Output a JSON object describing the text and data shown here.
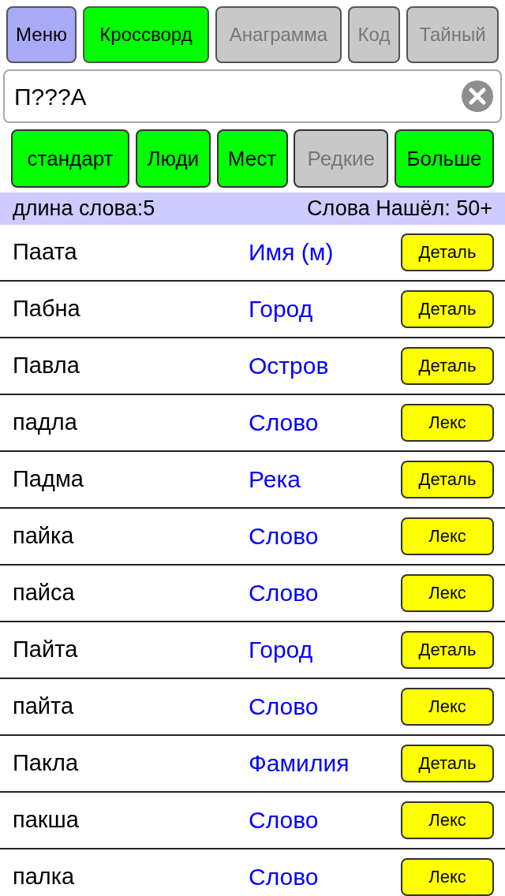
{
  "menu_button": "Меню",
  "tabs": [
    {
      "label": "Кроссворд",
      "selected": true
    },
    {
      "label": "Анаграмма",
      "selected": false
    },
    {
      "label": "Код",
      "selected": false
    },
    {
      "label": "Тайный",
      "selected": false
    }
  ],
  "search": {
    "value": "П???А"
  },
  "filters": [
    {
      "label": "стандарт",
      "on": true
    },
    {
      "label": "Люди",
      "on": true
    },
    {
      "label": "Мест",
      "on": true
    },
    {
      "label": "Редкие",
      "on": false
    },
    {
      "label": "Больше",
      "on": true
    }
  ],
  "info_bar": {
    "length": "длина слова:5",
    "found": "Слова Нашёл: 50+"
  },
  "rows": [
    {
      "word": "Паата",
      "type": "Имя (м)",
      "button": "Деталь"
    },
    {
      "word": "Пабна",
      "type": "Город",
      "button": "Деталь"
    },
    {
      "word": "Павла",
      "type": "Остров",
      "button": "Деталь"
    },
    {
      "word": "падла",
      "type": "Слово",
      "button": "Лекс"
    },
    {
      "word": "Падма",
      "type": "Река",
      "button": "Деталь"
    },
    {
      "word": "пайка",
      "type": "Слово",
      "button": "Лекс"
    },
    {
      "word": "пайса",
      "type": "Слово",
      "button": "Лекс"
    },
    {
      "word": "Пайта",
      "type": "Город",
      "button": "Деталь"
    },
    {
      "word": "пайта",
      "type": "Слово",
      "button": "Лекс"
    },
    {
      "word": "Пакла",
      "type": "Фамилия",
      "button": "Деталь"
    },
    {
      "word": "пакша",
      "type": "Слово",
      "button": "Лекс"
    },
    {
      "word": "палка",
      "type": "Слово",
      "button": "Лекс"
    }
  ]
}
